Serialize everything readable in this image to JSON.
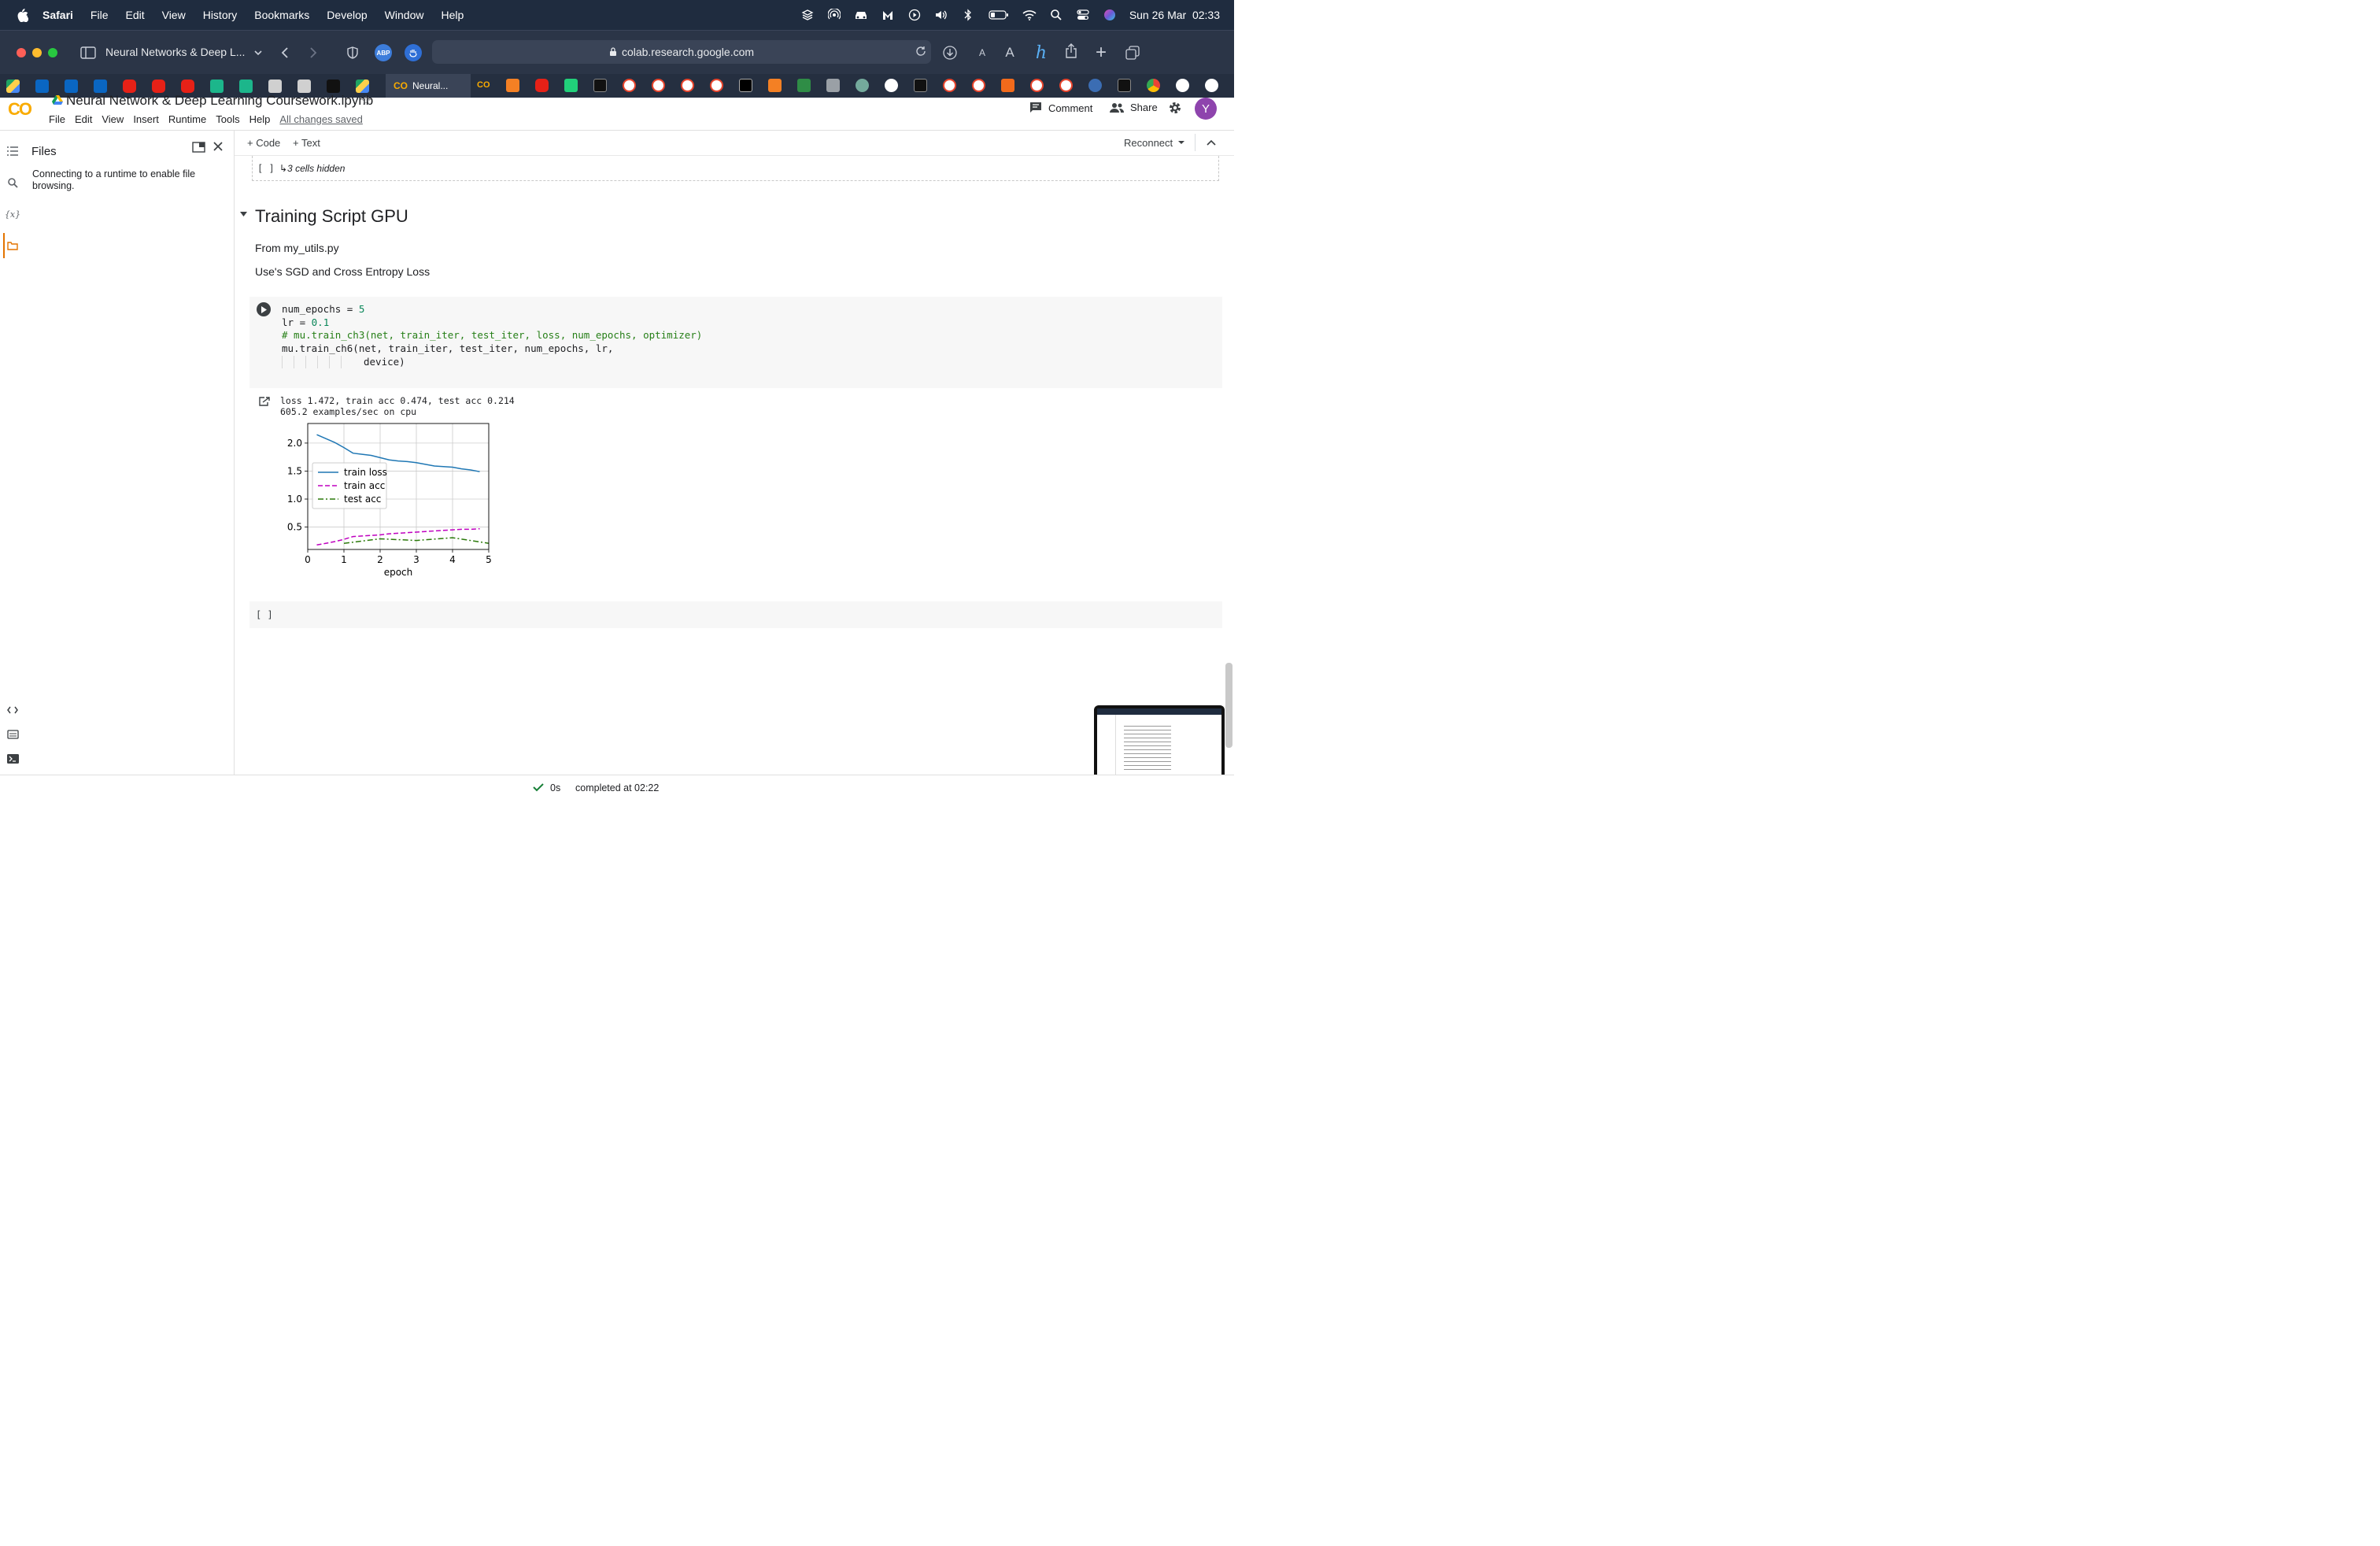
{
  "menubar": {
    "app": "Safari",
    "items": [
      "File",
      "Edit",
      "View",
      "History",
      "Bookmarks",
      "Develop",
      "Window",
      "Help"
    ],
    "clock": "Sun 26 Mar  02:33"
  },
  "browser": {
    "tab_group_title": "Neural Networks & Deep L...",
    "address": "colab.research.google.com",
    "active_tab_label": "Neural...",
    "abp_label": "ABP"
  },
  "colab": {
    "logo_text": "CO",
    "notebook_title": "Neural Network & Deep Learning Coursework.ipynb",
    "menu": [
      "File",
      "Edit",
      "View",
      "Insert",
      "Runtime",
      "Tools",
      "Help"
    ],
    "saved_status": "All changes saved",
    "comment_label": "Comment",
    "share_label": "Share",
    "avatar_letter": "Y"
  },
  "sidebar": {
    "title": "Files",
    "message": "Connecting to a runtime to enable file browsing.",
    "vars_label": "{x}"
  },
  "toolbar": {
    "code_label": "+ Code",
    "text_label": "+ Text",
    "reconnect_label": "Reconnect"
  },
  "hidden_cells": {
    "brackets": "[ ]",
    "label": "↳3 cells hidden"
  },
  "section": {
    "title": "Training Script GPU",
    "lines": [
      "From my_utils.py",
      "Use's SGD and Cross Entropy Loss"
    ]
  },
  "code": {
    "line1_a": "num_epochs = ",
    "line1_b": "5",
    "line2_a": "lr = ",
    "line2_b": "0.1",
    "line3": "# mu.train_ch3(net, train_iter, test_iter, loss, num_epochs, optimizer)",
    "line4": "mu.train_ch6(net, train_iter, test_iter, num_epochs, lr,",
    "line5": "device)"
  },
  "output": {
    "line1": "loss 1.472, train acc 0.474, test acc 0.214",
    "line2": "605.2 examples/sec on cpu"
  },
  "chart_data": {
    "type": "line",
    "xlabel": "epoch",
    "ylabel": "",
    "xlim": [
      0,
      5
    ],
    "ylim": [
      0.1,
      2.35
    ],
    "xticks": [
      0,
      1,
      2,
      3,
      4,
      5
    ],
    "yticks": [
      0.5,
      1.0,
      1.5,
      2.0
    ],
    "grid": true,
    "legend_position": "center-left",
    "series": [
      {
        "name": "train loss",
        "color": "#1f77b4",
        "dash": "solid",
        "x": [
          0.25,
          0.5,
          0.75,
          1.0,
          1.25,
          1.5,
          1.75,
          2.0,
          2.25,
          2.5,
          2.75,
          3.0,
          3.25,
          3.5,
          3.75,
          4.0,
          4.25,
          4.5,
          4.75
        ],
        "y": [
          2.15,
          2.08,
          2.01,
          1.92,
          1.82,
          1.8,
          1.78,
          1.74,
          1.7,
          1.68,
          1.67,
          1.65,
          1.62,
          1.59,
          1.58,
          1.57,
          1.54,
          1.52,
          1.49
        ]
      },
      {
        "name": "train acc",
        "color": "#bf00bf",
        "dash": "dashed",
        "x": [
          0.25,
          0.5,
          0.75,
          1.0,
          1.25,
          1.5,
          1.75,
          2.0,
          2.25,
          2.5,
          2.75,
          3.0,
          3.25,
          3.5,
          3.75,
          4.0,
          4.25,
          4.5,
          4.75
        ],
        "y": [
          0.18,
          0.21,
          0.24,
          0.28,
          0.33,
          0.34,
          0.35,
          0.36,
          0.38,
          0.39,
          0.4,
          0.41,
          0.42,
          0.43,
          0.44,
          0.45,
          0.46,
          0.46,
          0.47
        ]
      },
      {
        "name": "test acc",
        "color": "#2b7a0b",
        "dash": "dashdot",
        "x": [
          1,
          2,
          3,
          4,
          5
        ],
        "y": [
          0.21,
          0.29,
          0.26,
          0.31,
          0.21
        ]
      }
    ]
  },
  "empty_cell": {
    "brackets": "[ ]"
  },
  "status": {
    "duration": "0s",
    "completed": "completed at 02:22"
  }
}
